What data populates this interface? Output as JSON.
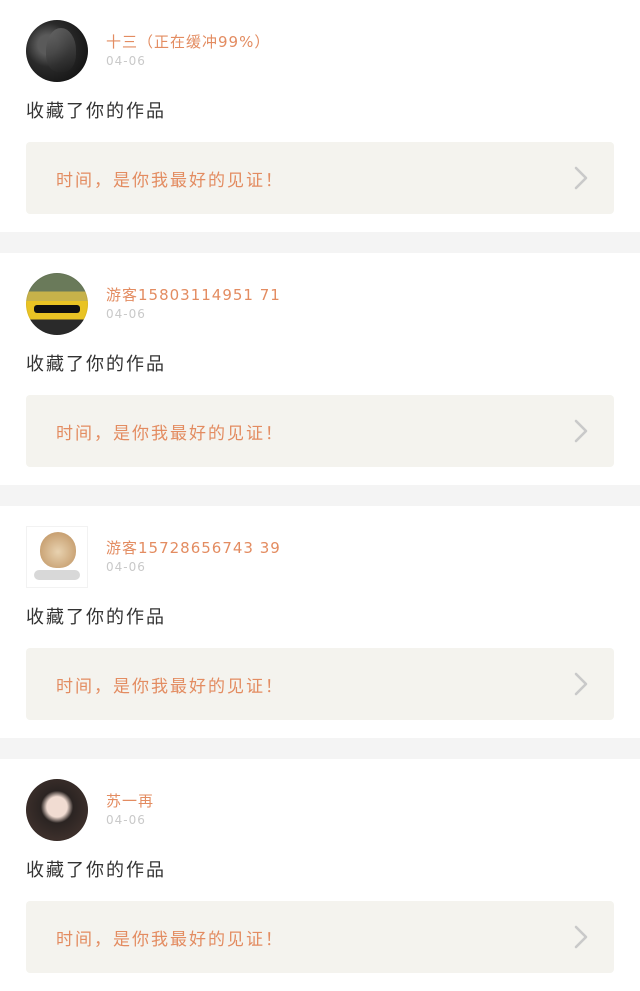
{
  "feed": [
    {
      "user": "十三（正在缓冲99%）",
      "time": "04-06",
      "avatar": "dark-portrait-avatar",
      "action": "收藏了你的作品",
      "work_title": "时间，是你我最好的见证！"
    },
    {
      "user": "游客15803114951 71",
      "time": "04-06",
      "avatar": "yellow-car-avatar",
      "action": "收藏了你的作品",
      "work_title": "时间，是你我最好的见证！"
    },
    {
      "user": "游客15728656743 39",
      "time": "04-06",
      "avatar": "cat-avatar",
      "action": "收藏了你的作品",
      "work_title": "时间，是你我最好的见证！"
    },
    {
      "user": "苏一再",
      "time": "04-06",
      "avatar": "girl-avatar",
      "action": "收藏了你的作品",
      "work_title": "时间，是你我最好的见证！"
    }
  ],
  "icons": {
    "chevron": "chevron-right-icon"
  },
  "colors": {
    "username": "#e38c61",
    "work_bg": "#f4f3ee",
    "separator": "#f4f4f4"
  }
}
